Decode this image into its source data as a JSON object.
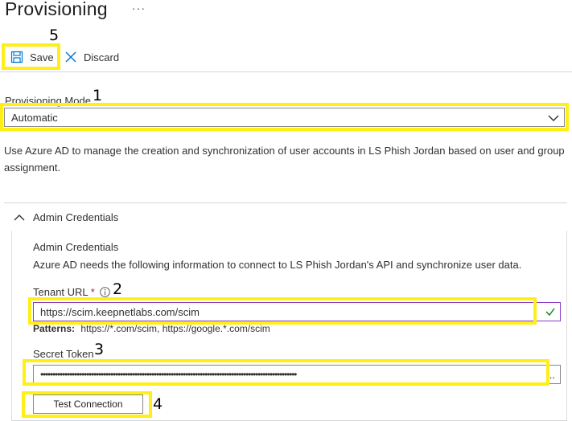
{
  "page": {
    "title": "Provisioning",
    "more_label": "···"
  },
  "toolbar": {
    "save_label": "Save",
    "discard_label": "Discard"
  },
  "annotations": {
    "n1": "1",
    "n2": "2",
    "n3": "3",
    "n4": "4",
    "n5": "5"
  },
  "mode": {
    "label": "Provisioning Mode",
    "value": "Automatic",
    "description": "Use Azure AD to manage the creation and synchronization of user accounts in LS Phish Jordan based on user and group assignment."
  },
  "credentials": {
    "section_title": "Admin Credentials",
    "heading": "Admin Credentials",
    "description": "Azure AD needs the following information to connect to LS Phish Jordan's API and synchronize user data.",
    "tenant_url_label": "Tenant URL",
    "required_mark": "*",
    "tenant_url_value": "https://scim.keepnetlabs.com/scim",
    "patterns_label": "Patterns:",
    "patterns_value": "https://*.com/scim, https://google.*.com/scim",
    "secret_token_label": "Secret Token",
    "secret_token_value": "••••••••••••••••••••••••••••••••••••••••••••••••••••••••••••••••••••••••••••••••••••••••••••••••••••••••••",
    "secret_token_more": "..",
    "test_connection_label": "Test Connection"
  },
  "colors": {
    "highlight": "#ffef17",
    "accent": "#0078d4",
    "required": "#a4262c",
    "valid": "#107c10"
  }
}
